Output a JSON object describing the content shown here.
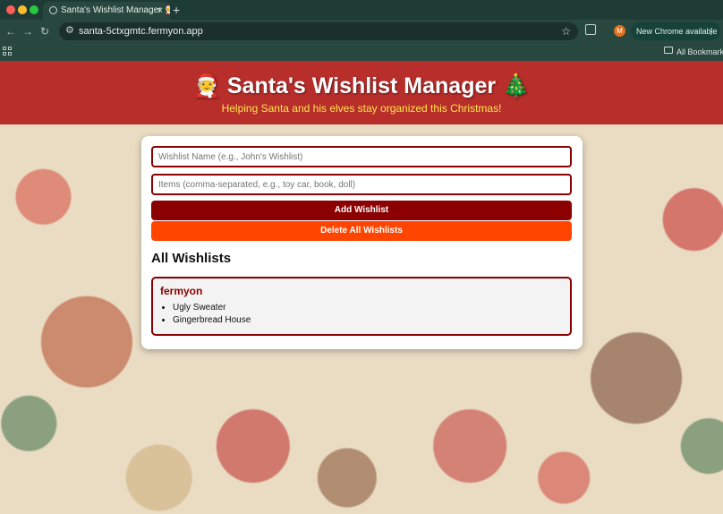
{
  "browser": {
    "tab_title": "Santa's Wishlist Manager 🧑‍🎄",
    "tab_close": "×",
    "new_tab": "+",
    "url": "santa-5ctxgmtc.fermyon.app",
    "profile_initial": "M",
    "update_label": "New Chrome available",
    "update_menu": "⋮",
    "bookmarks_label": "All Bookmarks",
    "icons": [
      "back-arrow-icon",
      "forward-arrow-icon",
      "reload-icon",
      "site-info-icon",
      "bookmark-star-icon",
      "extensions-icon",
      "apps-grid-icon",
      "folder-icon"
    ]
  },
  "header": {
    "title": "🧑‍🎄 Santa's Wishlist Manager 🎄",
    "subtitle": "Helping Santa and his elves stay organized this Christmas!"
  },
  "form": {
    "name_placeholder": "Wishlist Name (e.g., John's Wishlist)",
    "items_placeholder": "Items (comma-separated, e.g., toy car, book, doll)",
    "add_label": "Add Wishlist",
    "delete_all_label": "Delete All Wishlists"
  },
  "wishlists": {
    "heading": "All Wishlists",
    "entries": [
      {
        "name": "fermyon",
        "items": [
          "Ugly Sweater",
          "Gingerbread House"
        ]
      }
    ]
  },
  "colors": {
    "primary": "#8b0000",
    "danger": "#ff4500",
    "subtitle": "#ffe34d",
    "banner": "#b01212",
    "chrome": "#27473f"
  }
}
